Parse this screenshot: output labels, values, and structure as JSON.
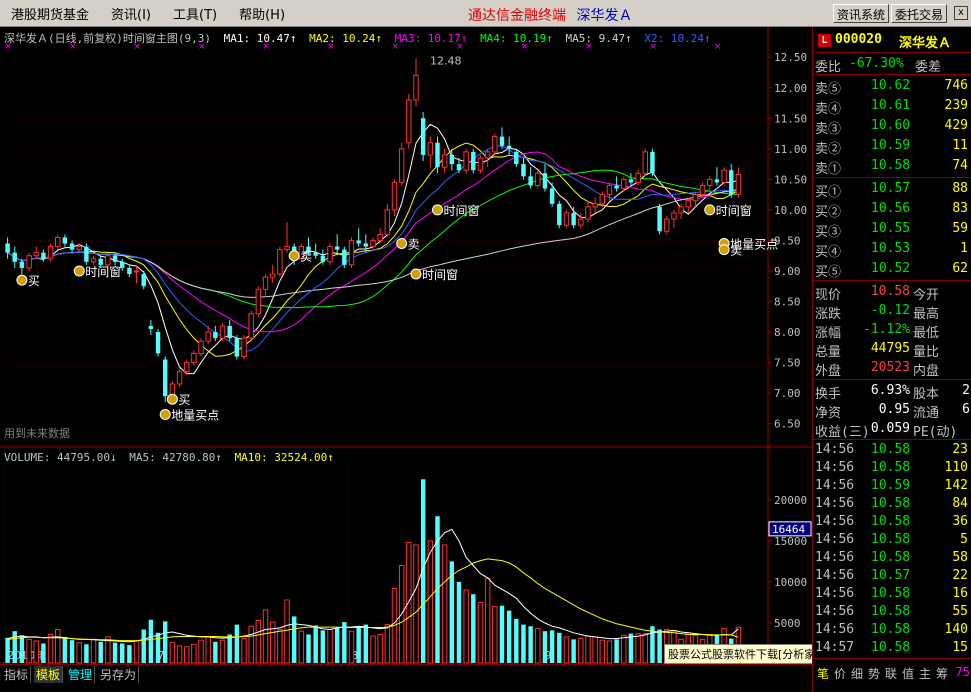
{
  "menu": {
    "items": [
      "港股期货基金",
      "资讯(I)",
      "工具(T)",
      "帮助(H)"
    ],
    "title_red": "通达信金融终端",
    "title_blue": "深华发Ａ",
    "btn_info": "资讯系统",
    "btn_trade": "委托交易",
    "close": "x"
  },
  "price_legend": {
    "title": "深华发Ａ(日线,前复权)时间窗主图(9,3)",
    "ma1": "MA1: 10.47↑",
    "ma2": "MA2: 10.24↑",
    "ma3": "MA3: 10.17↑",
    "ma4": "MA4: 10.19↑",
    "ma5": "MA5: 9.47↑",
    "x2": "X2: 10.24↑"
  },
  "vol_legend": {
    "volume": "VOLUME: 44795.00↓",
    "ma5": "MA5: 42780.80↑",
    "ma10": "MA10: 32524.00↑"
  },
  "colors": {
    "up": "#ff3030",
    "down": "#54fcfc",
    "ma1": "#ffffff",
    "ma2": "#ffff00",
    "ma3": "#ff00ff",
    "ma4": "#00ff00",
    "ma5": "#d0d0d0",
    "x2": "#3060ff",
    "axis": "#a00000"
  },
  "chart_data": [
    {
      "type": "candlestick",
      "y_ticks": [
        6.5,
        7.0,
        7.5,
        8.0,
        8.5,
        9.0,
        9.5,
        10.0,
        10.5,
        11.0,
        11.5,
        12.0,
        12.5
      ],
      "ylim": [
        6.2,
        12.7
      ],
      "x_labels": [
        {
          "i": 0,
          "label": "2010年"
        },
        {
          "i": 21,
          "label": "7"
        },
        {
          "i": 48,
          "label": "8"
        },
        {
          "i": 75,
          "label": "9"
        },
        {
          "i": 98,
          "label": "10"
        }
      ],
      "high_label": "12.48",
      "note": "用到未来数据",
      "candles": [
        [
          9.45,
          9.55,
          9.2,
          9.3
        ],
        [
          9.3,
          9.4,
          9.05,
          9.15
        ],
        [
          9.15,
          9.2,
          8.95,
          9.05
        ],
        [
          9.05,
          9.3,
          9.0,
          9.25
        ],
        [
          9.25,
          9.4,
          9.2,
          9.3
        ],
        [
          9.3,
          9.35,
          9.15,
          9.2
        ],
        [
          9.2,
          9.45,
          9.15,
          9.4
        ],
        [
          9.4,
          9.6,
          9.35,
          9.55
        ],
        [
          9.55,
          9.6,
          9.4,
          9.45
        ],
        [
          9.45,
          9.5,
          9.3,
          9.35
        ],
        [
          9.35,
          9.45,
          9.3,
          9.4
        ],
        [
          9.4,
          9.45,
          9.1,
          9.15
        ],
        [
          9.15,
          9.25,
          9.1,
          9.2
        ],
        [
          9.2,
          9.25,
          9.05,
          9.1
        ],
        [
          9.1,
          9.3,
          9.05,
          9.25
        ],
        [
          9.25,
          9.3,
          9.1,
          9.15
        ],
        [
          9.15,
          9.2,
          9.0,
          9.05
        ],
        [
          9.05,
          9.1,
          8.9,
          8.95
        ],
        [
          9.0,
          9.1,
          8.8,
          9.0
        ],
        [
          8.95,
          9.0,
          8.7,
          8.75
        ],
        [
          8.1,
          8.2,
          7.95,
          8.05
        ],
        [
          8.0,
          8.05,
          7.6,
          7.65
        ],
        [
          7.55,
          7.6,
          6.85,
          6.95
        ],
        [
          6.95,
          7.2,
          6.9,
          7.15
        ],
        [
          7.15,
          7.4,
          7.1,
          7.35
        ],
        [
          7.35,
          7.55,
          7.3,
          7.5
        ],
        [
          7.5,
          7.7,
          7.45,
          7.65
        ],
        [
          7.65,
          7.9,
          7.6,
          7.85
        ],
        [
          7.85,
          8.1,
          7.8,
          8.0
        ],
        [
          8.0,
          8.1,
          7.85,
          7.9
        ],
        [
          7.9,
          8.15,
          7.85,
          8.1
        ],
        [
          8.1,
          8.2,
          7.85,
          7.9
        ],
        [
          7.9,
          7.95,
          7.55,
          7.6
        ],
        [
          7.6,
          7.95,
          7.55,
          7.9
        ],
        [
          7.9,
          8.35,
          7.85,
          8.3
        ],
        [
          8.3,
          8.75,
          8.25,
          8.7
        ],
        [
          8.7,
          8.95,
          8.6,
          8.9
        ],
        [
          8.9,
          9.1,
          8.8,
          8.95
        ],
        [
          8.95,
          9.4,
          8.9,
          9.35
        ],
        [
          9.35,
          9.8,
          9.3,
          9.4
        ],
        [
          9.4,
          9.45,
          9.1,
          9.2
        ],
        [
          9.2,
          9.45,
          9.15,
          9.4
        ],
        [
          9.4,
          9.55,
          9.25,
          9.3
        ],
        [
          9.3,
          9.45,
          9.2,
          9.25
        ],
        [
          9.25,
          9.35,
          9.1,
          9.15
        ],
        [
          9.15,
          9.45,
          9.1,
          9.4
        ],
        [
          9.4,
          9.6,
          9.3,
          9.35
        ],
        [
          9.35,
          9.4,
          9.05,
          9.1
        ],
        [
          9.1,
          9.55,
          9.05,
          9.5
        ],
        [
          9.5,
          9.7,
          9.4,
          9.45
        ],
        [
          9.45,
          9.6,
          9.3,
          9.4
        ],
        [
          9.4,
          9.55,
          9.35,
          9.5
        ],
        [
          9.5,
          9.7,
          9.45,
          9.6
        ],
        [
          9.6,
          10.1,
          9.55,
          10.0
        ],
        [
          10.0,
          10.5,
          9.9,
          10.45
        ],
        [
          10.45,
          11.1,
          10.4,
          11.0
        ],
        [
          11.1,
          11.9,
          11.0,
          11.8
        ],
        [
          11.8,
          12.48,
          11.7,
          12.2
        ],
        [
          11.5,
          11.6,
          10.8,
          10.9
        ],
        [
          10.9,
          11.2,
          10.7,
          11.1
        ],
        [
          11.1,
          11.2,
          10.6,
          10.7
        ],
        [
          10.7,
          11.0,
          10.6,
          10.9
        ],
        [
          10.9,
          11.0,
          10.65,
          10.75
        ],
        [
          10.75,
          10.85,
          10.6,
          10.65
        ],
        [
          10.65,
          11.0,
          10.6,
          10.95
        ],
        [
          10.95,
          11.0,
          10.6,
          10.65
        ],
        [
          10.65,
          10.9,
          10.6,
          10.85
        ],
        [
          10.85,
          11.0,
          10.7,
          10.95
        ],
        [
          10.95,
          11.25,
          10.9,
          11.2
        ],
        [
          11.2,
          11.35,
          11.0,
          11.05
        ],
        [
          11.05,
          11.2,
          10.9,
          11.0
        ],
        [
          10.95,
          11.0,
          10.7,
          10.75
        ],
        [
          10.75,
          10.85,
          10.5,
          10.55
        ],
        [
          10.55,
          10.7,
          10.35,
          10.4
        ],
        [
          10.4,
          10.65,
          10.35,
          10.6
        ],
        [
          10.6,
          10.75,
          10.3,
          10.35
        ],
        [
          10.35,
          10.45,
          10.05,
          10.1
        ],
        [
          10.1,
          10.15,
          9.7,
          9.75
        ],
        [
          9.75,
          10.0,
          9.7,
          9.95
        ],
        [
          9.95,
          10.05,
          9.7,
          9.75
        ],
        [
          9.75,
          9.95,
          9.7,
          9.85
        ],
        [
          9.85,
          10.15,
          9.8,
          10.05
        ],
        [
          10.05,
          10.2,
          9.95,
          10.1
        ],
        [
          10.1,
          10.3,
          10.05,
          10.25
        ],
        [
          10.25,
          10.45,
          10.15,
          10.4
        ],
        [
          10.4,
          10.55,
          10.3,
          10.35
        ],
        [
          10.35,
          10.55,
          10.3,
          10.5
        ],
        [
          10.5,
          10.6,
          10.4,
          10.45
        ],
        [
          10.45,
          10.65,
          10.4,
          10.6
        ],
        [
          10.6,
          11.0,
          10.55,
          10.95
        ],
        [
          10.95,
          11.0,
          10.55,
          10.6
        ],
        [
          10.05,
          10.1,
          9.6,
          9.65
        ],
        [
          9.65,
          9.9,
          9.6,
          9.85
        ],
        [
          9.85,
          10.0,
          9.7,
          9.95
        ],
        [
          9.95,
          10.1,
          9.85,
          10.05
        ],
        [
          10.05,
          10.2,
          9.95,
          10.15
        ],
        [
          10.15,
          10.3,
          10.05,
          10.25
        ],
        [
          10.25,
          10.45,
          10.2,
          10.4
        ],
        [
          10.4,
          10.55,
          10.3,
          10.5
        ],
        [
          10.5,
          10.7,
          10.4,
          10.45
        ],
        [
          10.45,
          10.7,
          10.4,
          10.65
        ],
        [
          10.65,
          10.75,
          10.2,
          10.25
        ],
        [
          10.25,
          10.7,
          10.2,
          10.58
        ]
      ],
      "signals": [
        {
          "i": 2,
          "label": "买",
          "price": 8.85
        },
        {
          "i": 10,
          "label": "时间窗",
          "price": 9.0
        },
        {
          "i": 23,
          "label": "买",
          "price": 6.9
        },
        {
          "i": 22,
          "label": "地量买点",
          "price": 6.65
        },
        {
          "i": 40,
          "label": "卖",
          "price": 9.25
        },
        {
          "i": 55,
          "label": "卖",
          "price": 9.45
        },
        {
          "i": 57,
          "label": "时间窗",
          "price": 8.95
        },
        {
          "i": 60,
          "label": "时间窗",
          "price": 10.0
        },
        {
          "i": 98,
          "label": "时间窗",
          "price": 10.0
        },
        {
          "i": 100,
          "label": "地量买点",
          "price": 9.45
        },
        {
          "i": 100,
          "label": "卖",
          "price": 9.35
        }
      ]
    },
    {
      "type": "bar",
      "ylabel": "X10",
      "y_ticks": [
        5000,
        10000,
        15000,
        20000
      ],
      "ylim": [
        0,
        24000
      ],
      "current_label": "16464",
      "values": [
        3200,
        4000,
        3500,
        3000,
        2800,
        2500,
        3600,
        4200,
        3300,
        2900,
        2600,
        2400,
        3000,
        2700,
        3300,
        2600,
        2500,
        2300,
        2800,
        4200,
        5400,
        3800,
        5200,
        2600,
        2200,
        2100,
        2400,
        2900,
        3300,
        2700,
        2900,
        3600,
        4800,
        3100,
        4600,
        5300,
        6600,
        5100,
        4200,
        7800,
        5800,
        4000,
        3600,
        4700,
        4100,
        4200,
        4400,
        5100,
        4000,
        4600,
        4800,
        3400,
        3600,
        4800,
        9200,
        12000,
        14800,
        14500,
        22500,
        15000,
        18000,
        14500,
        12500,
        10000,
        9000,
        8500,
        7500,
        10400,
        7000,
        7100,
        6500,
        5500,
        4800,
        4600,
        4300,
        4000,
        4100,
        3800,
        3300,
        3000,
        3100,
        3400,
        3300,
        2900,
        2800,
        3000,
        3500,
        3700,
        3700,
        3700,
        4600,
        4200,
        4200,
        4000,
        3000,
        3800,
        3500,
        3000,
        3600,
        3600,
        4300,
        3100,
        4479
      ],
      "ma5": [
        3100,
        3300,
        3400,
        3300,
        3300,
        3200,
        3250,
        3300,
        3200,
        3100,
        3000,
        3000,
        2950,
        2900,
        2850,
        2800,
        2750,
        2700,
        2800,
        3000,
        3300,
        3500,
        3800,
        3900,
        3700,
        3500,
        3400,
        3300,
        3300,
        3200,
        3150,
        3200,
        3300,
        3400,
        3600,
        3900,
        4200,
        4300,
        4400,
        4700,
        4900,
        4800,
        4700,
        4500,
        4300,
        4200,
        4400,
        4500,
        4500,
        4600,
        4500,
        4400,
        4300,
        4400,
        5000,
        6100,
        7600,
        9200,
        11700,
        13600,
        15000,
        16000,
        16400,
        15000,
        13000,
        12000,
        11000,
        10500,
        9600,
        9100,
        8600,
        8000,
        7000,
        6200,
        5500,
        5000,
        4600,
        4400,
        4100,
        3800,
        3600,
        3400,
        3300,
        3200,
        3100,
        3100,
        3200,
        3300,
        3400,
        3550,
        3800,
        3900,
        4000,
        4100,
        3900,
        3800,
        3700,
        3600,
        3500,
        3500,
        3600,
        3550,
        4278
      ],
      "ma10": [
        3000,
        3100,
        3200,
        3250,
        3250,
        3200,
        3200,
        3200,
        3150,
        3100,
        3050,
        3000,
        3000,
        2950,
        2950,
        2900,
        2850,
        2850,
        2850,
        2900,
        3000,
        3100,
        3200,
        3300,
        3350,
        3350,
        3350,
        3350,
        3350,
        3350,
        3300,
        3300,
        3300,
        3350,
        3400,
        3550,
        3700,
        3850,
        4000,
        4100,
        4300,
        4400,
        4500,
        4500,
        4500,
        4500,
        4500,
        4450,
        4450,
        4450,
        4450,
        4450,
        4450,
        4500,
        4700,
        5100,
        5700,
        6300,
        7300,
        8200,
        9200,
        10000,
        10800,
        11400,
        11800,
        12300,
        12600,
        12800,
        12700,
        12600,
        12300,
        11800,
        11100,
        10500,
        9800,
        9200,
        8700,
        8200,
        7700,
        7200,
        6700,
        6300,
        5900,
        5500,
        5200,
        4900,
        4700,
        4500,
        4300,
        4100,
        4000,
        3900,
        3850,
        3800,
        3700,
        3600,
        3600,
        3600,
        3550,
        3550,
        3550,
        3550,
        3252
      ]
    }
  ],
  "rpanel": {
    "badge": "L",
    "code": "000020",
    "name": "深华发Ａ",
    "weibi_label": "委比",
    "weibi_value": "-67.30%",
    "weicha_label": "委差",
    "asks": [
      {
        "label": "卖⑤",
        "price": "10.62",
        "vol": "746"
      },
      {
        "label": "卖④",
        "price": "10.61",
        "vol": "239"
      },
      {
        "label": "卖③",
        "price": "10.60",
        "vol": "429"
      },
      {
        "label": "卖②",
        "price": "10.59",
        "vol": "11"
      },
      {
        "label": "卖①",
        "price": "10.58",
        "vol": "74"
      }
    ],
    "bids": [
      {
        "label": "买①",
        "price": "10.57",
        "vol": "88"
      },
      {
        "label": "买②",
        "price": "10.56",
        "vol": "83"
      },
      {
        "label": "买③",
        "price": "10.55",
        "vol": "59"
      },
      {
        "label": "买④",
        "price": "10.53",
        "vol": "1"
      },
      {
        "label": "买⑤",
        "price": "10.52",
        "vol": "62"
      }
    ],
    "quote": [
      {
        "l1": "现价",
        "v1": "10.58",
        "c1": "up",
        "l2": "今开"
      },
      {
        "l1": "涨跌",
        "v1": "-0.12",
        "c1": "dn",
        "l2": "最高"
      },
      {
        "l1": "涨幅",
        "v1": "-1.12%",
        "c1": "dn",
        "l2": "最低"
      },
      {
        "l1": "总量",
        "v1": "44795",
        "c1": "vol",
        "l2": "量比"
      },
      {
        "l1": "外盘",
        "v1": "20523",
        "c1": "up",
        "l2": "内盘"
      }
    ],
    "fin": [
      {
        "l1": "换手",
        "v1": "6.93%",
        "l2": "股本",
        "v2": "2"
      },
      {
        "l1": "净资",
        "v1": "0.95",
        "l2": "流通",
        "v2": "6"
      },
      {
        "l1": "收益(三)",
        "v1": "0.059",
        "l2": "PE(动)",
        "v2": ""
      }
    ],
    "ticks": [
      {
        "t": "14:56",
        "p": "10.58",
        "v": "23"
      },
      {
        "t": "14:56",
        "p": "10.58",
        "v": "110"
      },
      {
        "t": "14:56",
        "p": "10.59",
        "v": "142"
      },
      {
        "t": "14:56",
        "p": "10.58",
        "v": "84"
      },
      {
        "t": "14:56",
        "p": "10.58",
        "v": "36"
      },
      {
        "t": "14:56",
        "p": "10.58",
        "v": "5"
      },
      {
        "t": "14:56",
        "p": "10.58",
        "v": "58"
      },
      {
        "t": "14:56",
        "p": "10.57",
        "v": "22"
      },
      {
        "t": "14:56",
        "p": "10.58",
        "v": "16"
      },
      {
        "t": "14:56",
        "p": "10.58",
        "v": "55"
      },
      {
        "t": "14:56",
        "p": "10.58",
        "v": "140"
      },
      {
        "t": "14:57",
        "p": "10.58",
        "v": "15"
      }
    ],
    "tabs": [
      "笔",
      "价",
      "细",
      "势",
      "联",
      "值",
      "主",
      "筹"
    ],
    "last_vol": "75"
  },
  "bottom": {
    "tabs": [
      "指标",
      "模板",
      "管理",
      "另存为"
    ],
    "watermark": "股票公式股票软件下载[分析家公式网www.88gs.com]"
  }
}
